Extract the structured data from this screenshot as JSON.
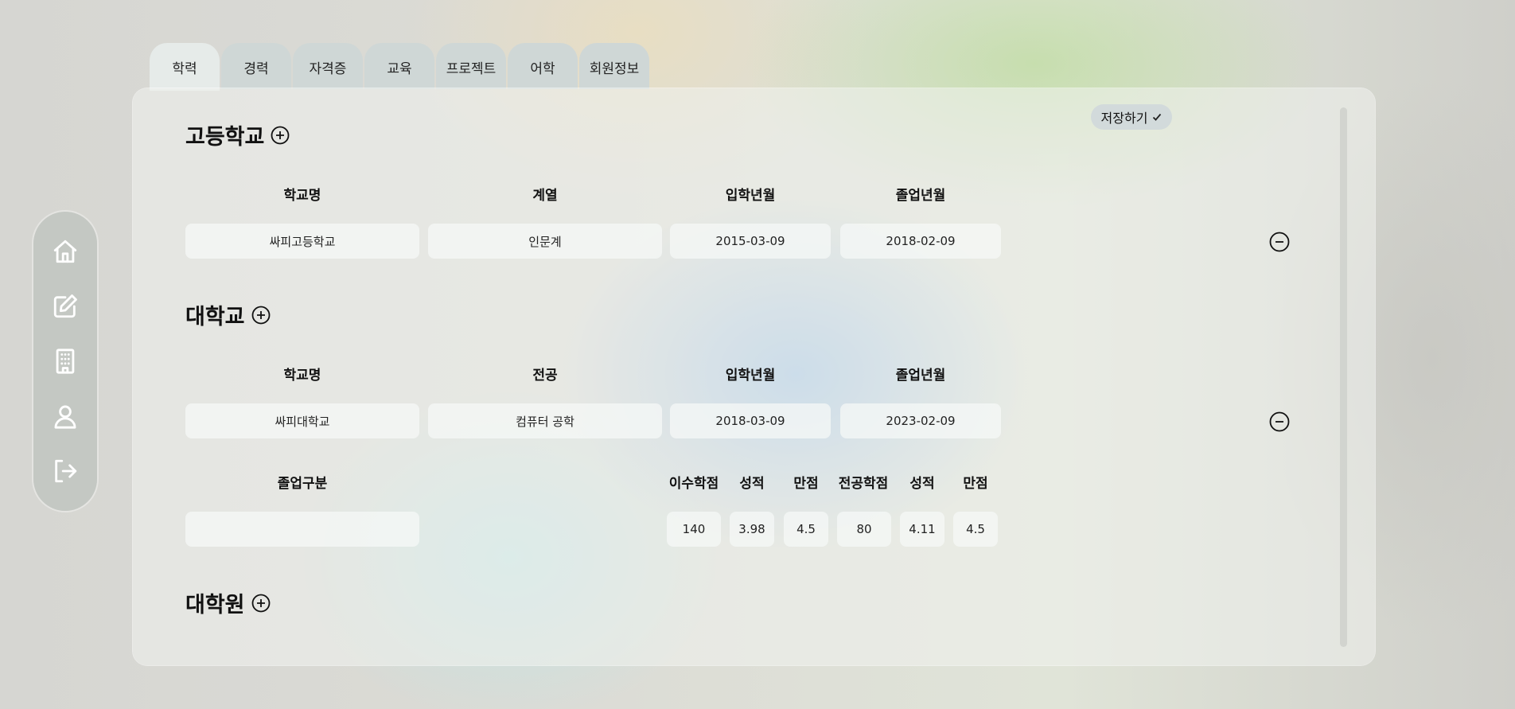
{
  "tabs": [
    "학력",
    "경력",
    "자격증",
    "교육",
    "프로젝트",
    "어학",
    "회원정보"
  ],
  "save_button": "저장하기",
  "high_school": {
    "title": "고등학교",
    "headers": {
      "school": "학교명",
      "track": "계열",
      "admission": "입학년월",
      "graduation": "졸업년월"
    },
    "row": {
      "school": "싸피고등학교",
      "track": "인문계",
      "admission": "2015-03-09",
      "graduation": "2018-02-09"
    }
  },
  "university": {
    "title": "대학교",
    "headers": {
      "school": "학교명",
      "major": "전공",
      "admission": "입학년월",
      "graduation": "졸업년월"
    },
    "row": {
      "school": "싸피대학교",
      "major": "컴퓨터 공학",
      "admission": "2018-03-09",
      "graduation": "2023-02-09"
    },
    "grad_headers": {
      "grad_type": "졸업구분",
      "credits": "이수학점",
      "gpa": "성적",
      "gpa_max": "만점",
      "major_credits": "전공학점",
      "major_gpa": "성적",
      "major_gpa_max": "만점"
    },
    "grad_row": {
      "grad_type": "",
      "credits": "140",
      "gpa": "3.98",
      "gpa_max": "4.5",
      "major_credits": "80",
      "major_gpa": "4.11",
      "major_gpa_max": "4.5"
    }
  },
  "grad_school": {
    "title": "대학원"
  },
  "nav_icons": [
    "home-icon",
    "edit-icon",
    "building-icon",
    "user-icon",
    "logout-icon"
  ]
}
